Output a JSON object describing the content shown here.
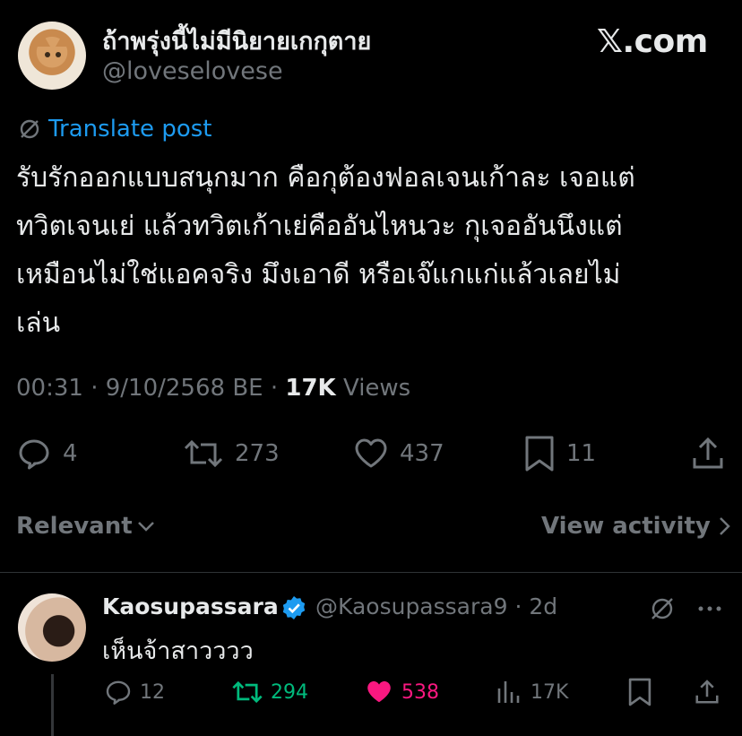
{
  "post": {
    "author_name": "ถ้าพรุ่งนี้ไม่มีนิยายเกกุตาย",
    "author_handle": "@loveselovese",
    "brand": "𝕏.com",
    "translate_label": "Translate post",
    "text": "รับรักออกแบบสนุกมาก คือกุต้องฟอลเจนเก้าละ เจอแต่\nทวิตเจนเย่ แล้วทวิตเก้าเย่คืออันไหนวะ กุเจออันนึงแต่\nเหมือนไม่ใช่แอคจริง มึงเอาดี หรือเจ๊แกแก่แล้วเลยไม่\nเล่น",
    "time": "00:31",
    "sep1": " · ",
    "date": "9/10/2568 BE",
    "sep2": " · ",
    "views_count": "17K",
    "views_label": " Views",
    "replies": "4",
    "reposts": "273",
    "likes": "437",
    "bookmarks": "11"
  },
  "replies_header": {
    "sort_label": "Relevant",
    "view_activity_label": "View activity"
  },
  "reply": {
    "name": "Kaosupassara",
    "handle": "@Kaosupassara9",
    "age": " · 2d",
    "text": "เห็นจ้าสาวววว",
    "replies": "12",
    "reposts": "294",
    "likes": "538",
    "views": "17K"
  },
  "colors": {
    "background": "#000000",
    "text": "#e7e9ea",
    "muted": "#71767b",
    "link": "#1d9bf0",
    "repost_active": "#00ba7c",
    "like_active": "#f91880",
    "verified": "#1d9bf0"
  },
  "icons": [
    "translate-icon",
    "reply-icon",
    "repost-icon",
    "like-icon",
    "bookmark-icon",
    "share-icon",
    "chevron-down-icon",
    "chevron-right-icon",
    "verified-icon",
    "grok-icon",
    "more-icon",
    "views-icon"
  ]
}
